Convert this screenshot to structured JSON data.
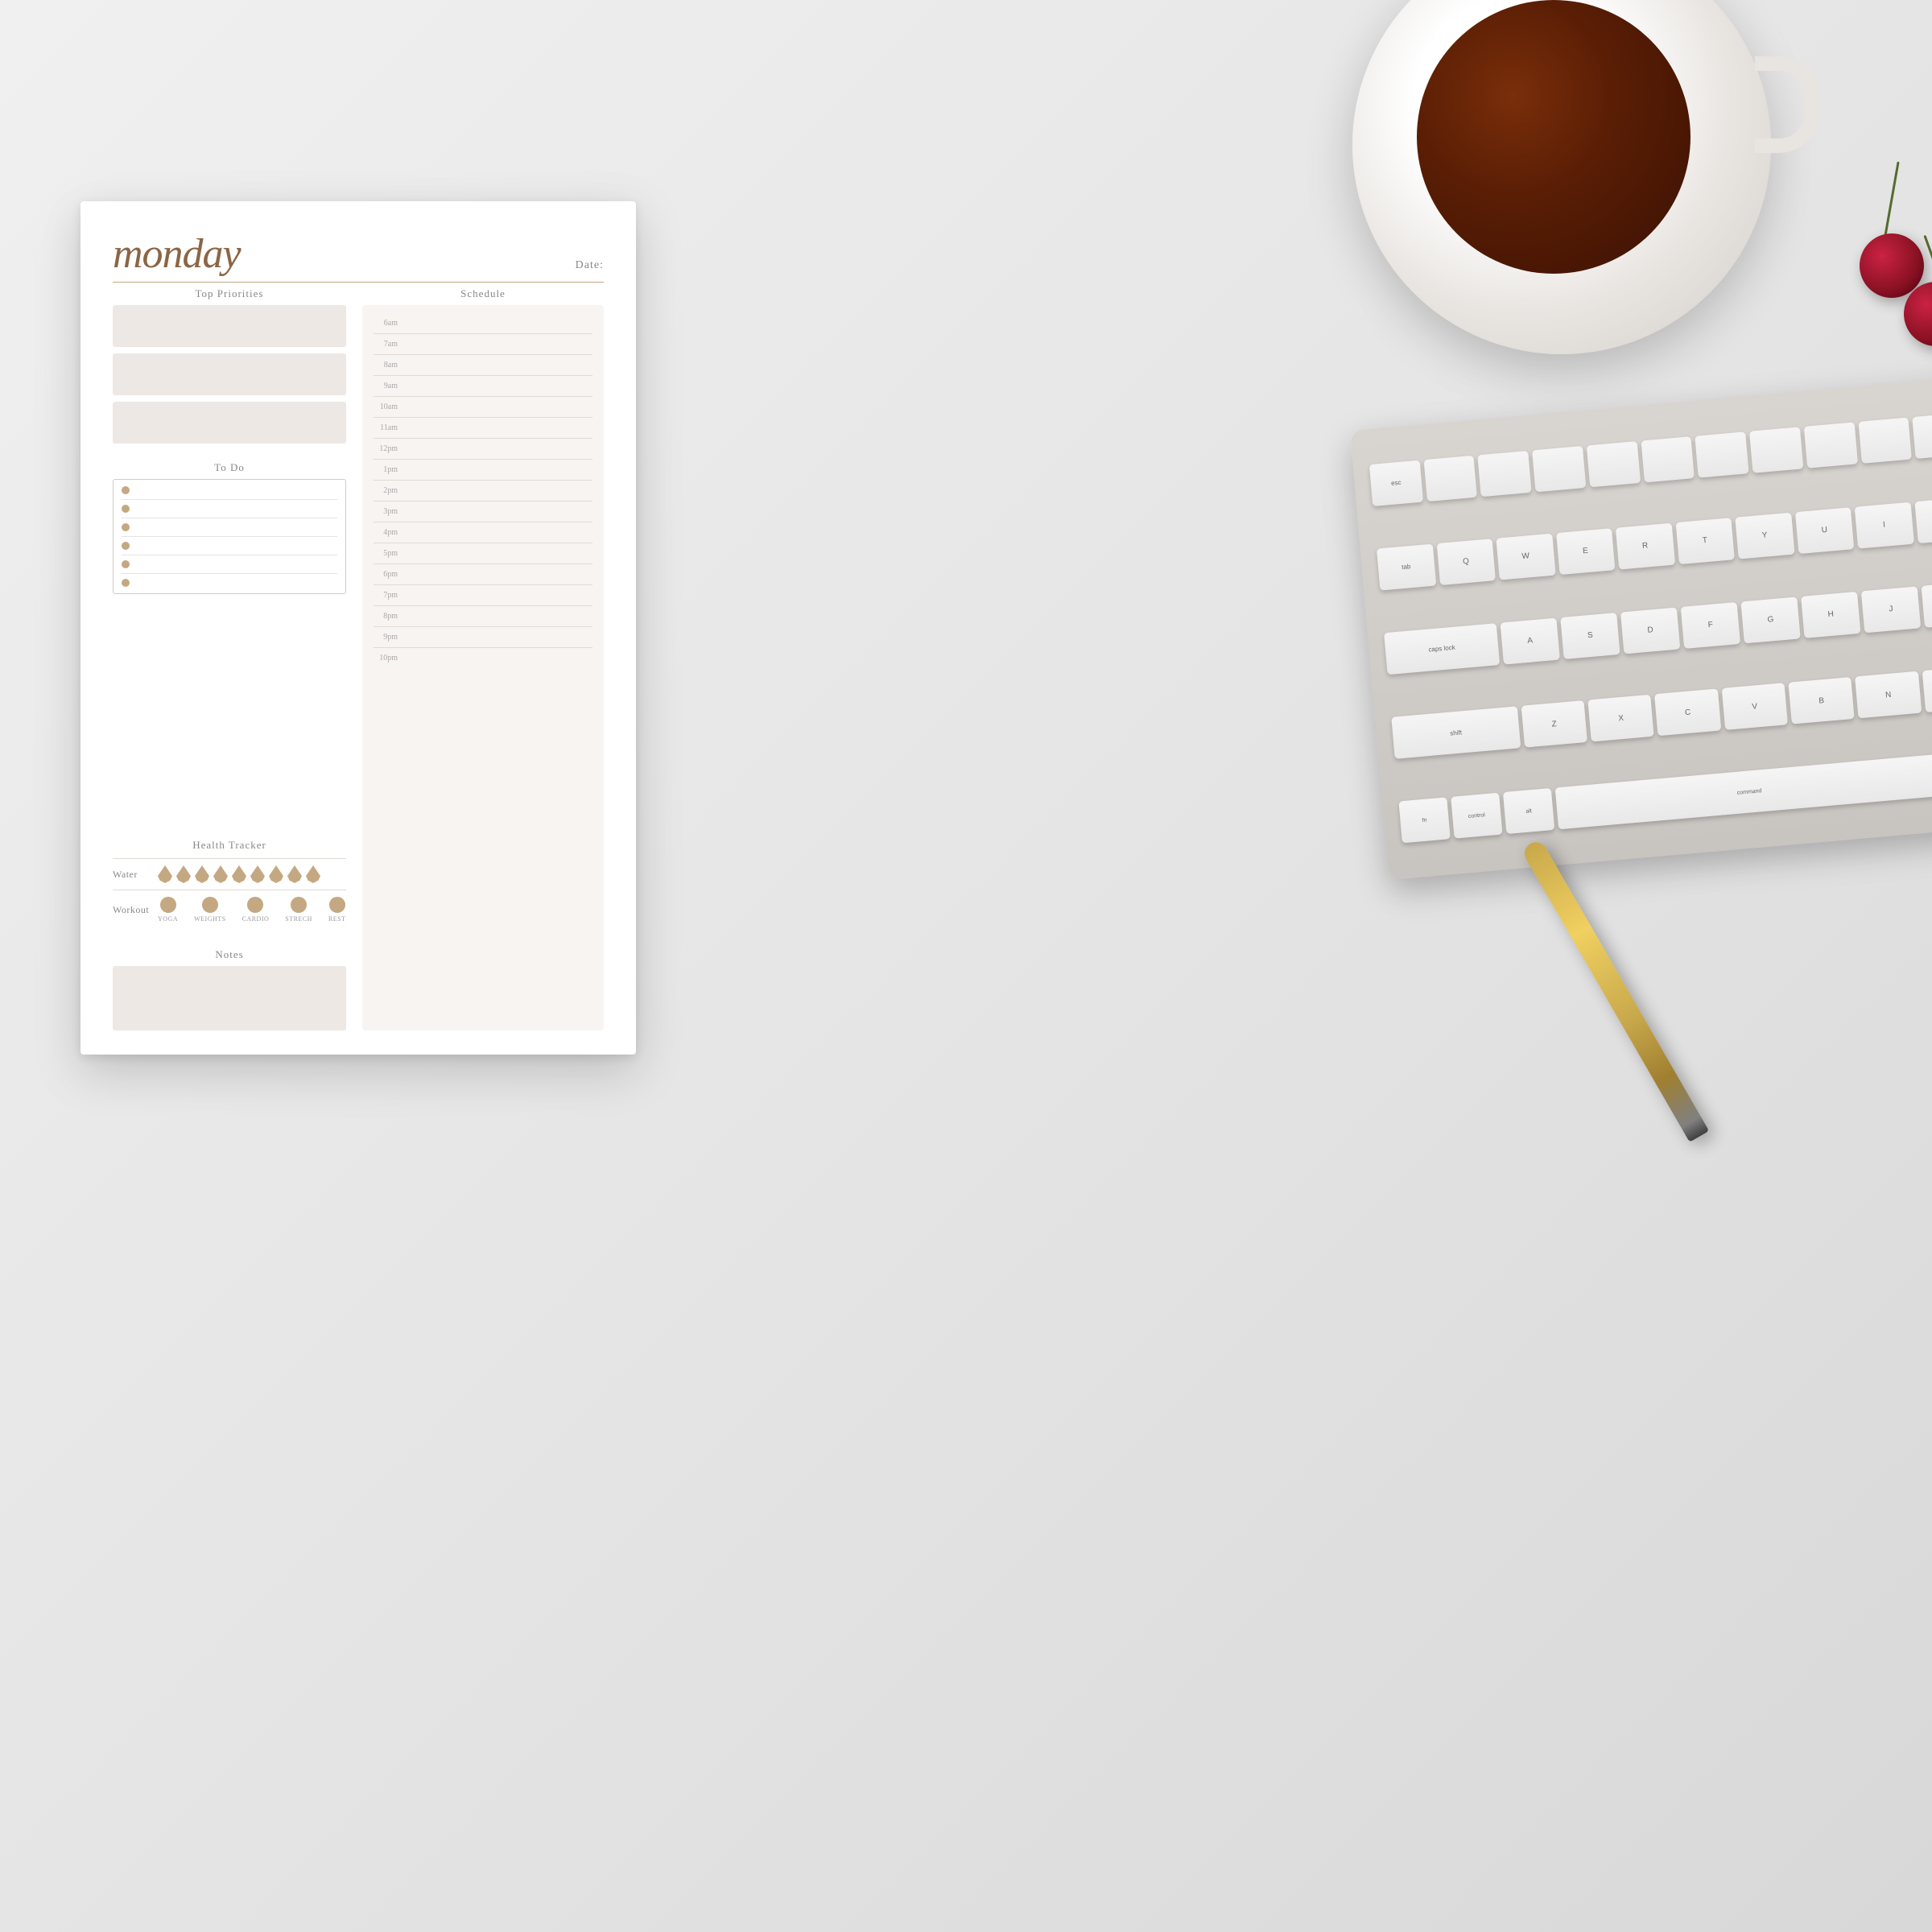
{
  "background": {
    "color": "#e8e8e8"
  },
  "planner": {
    "day": "monday",
    "date_label": "Date:",
    "sections": {
      "top_priorities": {
        "title": "Top Priorities",
        "boxes": 3
      },
      "todo": {
        "title": "To Do",
        "items": 6
      },
      "health_tracker": {
        "title": "Health Tracker",
        "water_label": "Water",
        "water_drops": 9,
        "workout_label": "Workout",
        "workout_types": [
          "YOGA",
          "WEIGHTS",
          "CARDIO",
          "STRECH",
          "REST"
        ]
      },
      "schedule": {
        "title": "Schedule",
        "time_slots": [
          "6am",
          "7am",
          "8am",
          "9am",
          "10am",
          "11am",
          "12pm",
          "1pm",
          "2pm",
          "3pm",
          "4pm",
          "5pm",
          "6pm",
          "7pm",
          "8pm",
          "9pm",
          "10pm"
        ]
      },
      "notes": {
        "title": "Notes"
      }
    }
  }
}
